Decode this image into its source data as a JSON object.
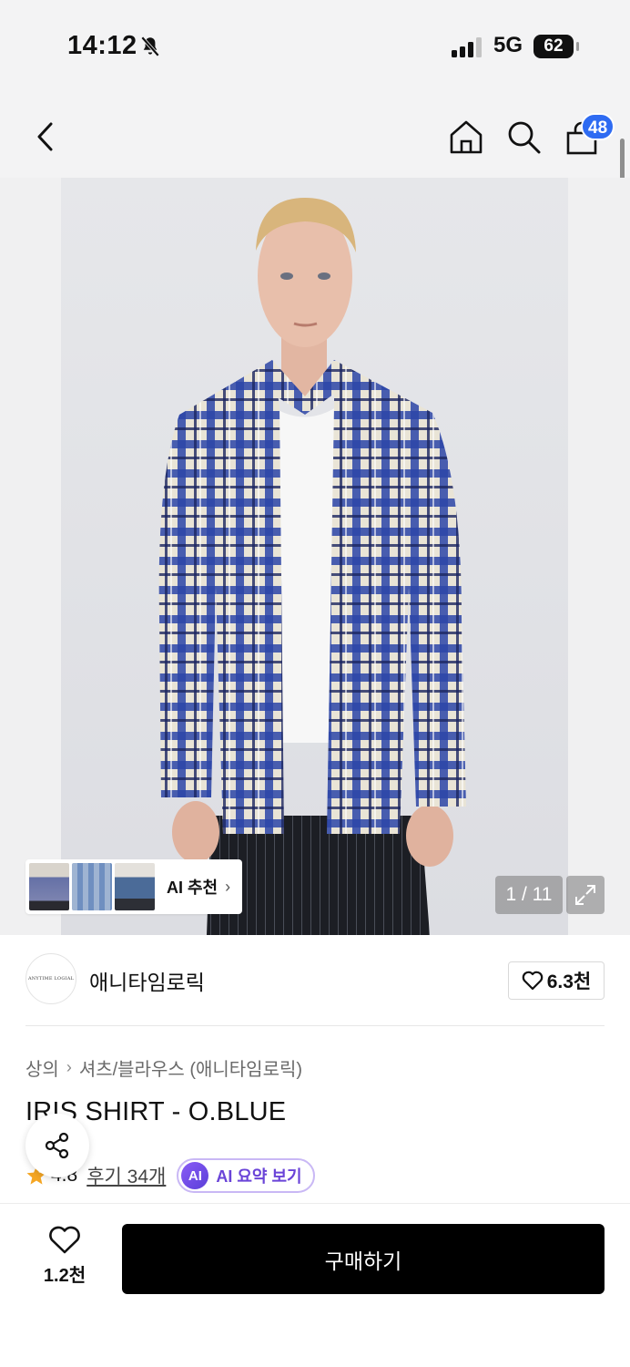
{
  "status_bar": {
    "time": "14:12",
    "network": "5G",
    "battery": "62"
  },
  "nav": {
    "cart_count": "48",
    "icons": [
      "back-icon",
      "home-icon",
      "search-icon",
      "cart-icon"
    ]
  },
  "gallery": {
    "ai_recommend_label": "AI 추천",
    "counter": "1 / 11",
    "thumbnail_count": 3
  },
  "brand": {
    "logo_text": "ANYTIME LOGIAL",
    "name": "애니타임로릭",
    "likes": "6.3천"
  },
  "product": {
    "breadcrumb": [
      "상의",
      "셔츠/블라우스 (애니타임로릭)"
    ],
    "title": "IRIS SHIRT - O.BLUE",
    "rating": "4.8",
    "reviews": "후기 34개",
    "ai_badge": "AI",
    "ai_summary_label": "AI 요약 보기"
  },
  "bottom": {
    "wish_count": "1.2천",
    "buy_label": "구매하기"
  },
  "colors": {
    "accent_blue": "#2e6bf2",
    "ai_purple": "#6a44d8",
    "star": "#f5a623",
    "buy_button": "#000000"
  }
}
